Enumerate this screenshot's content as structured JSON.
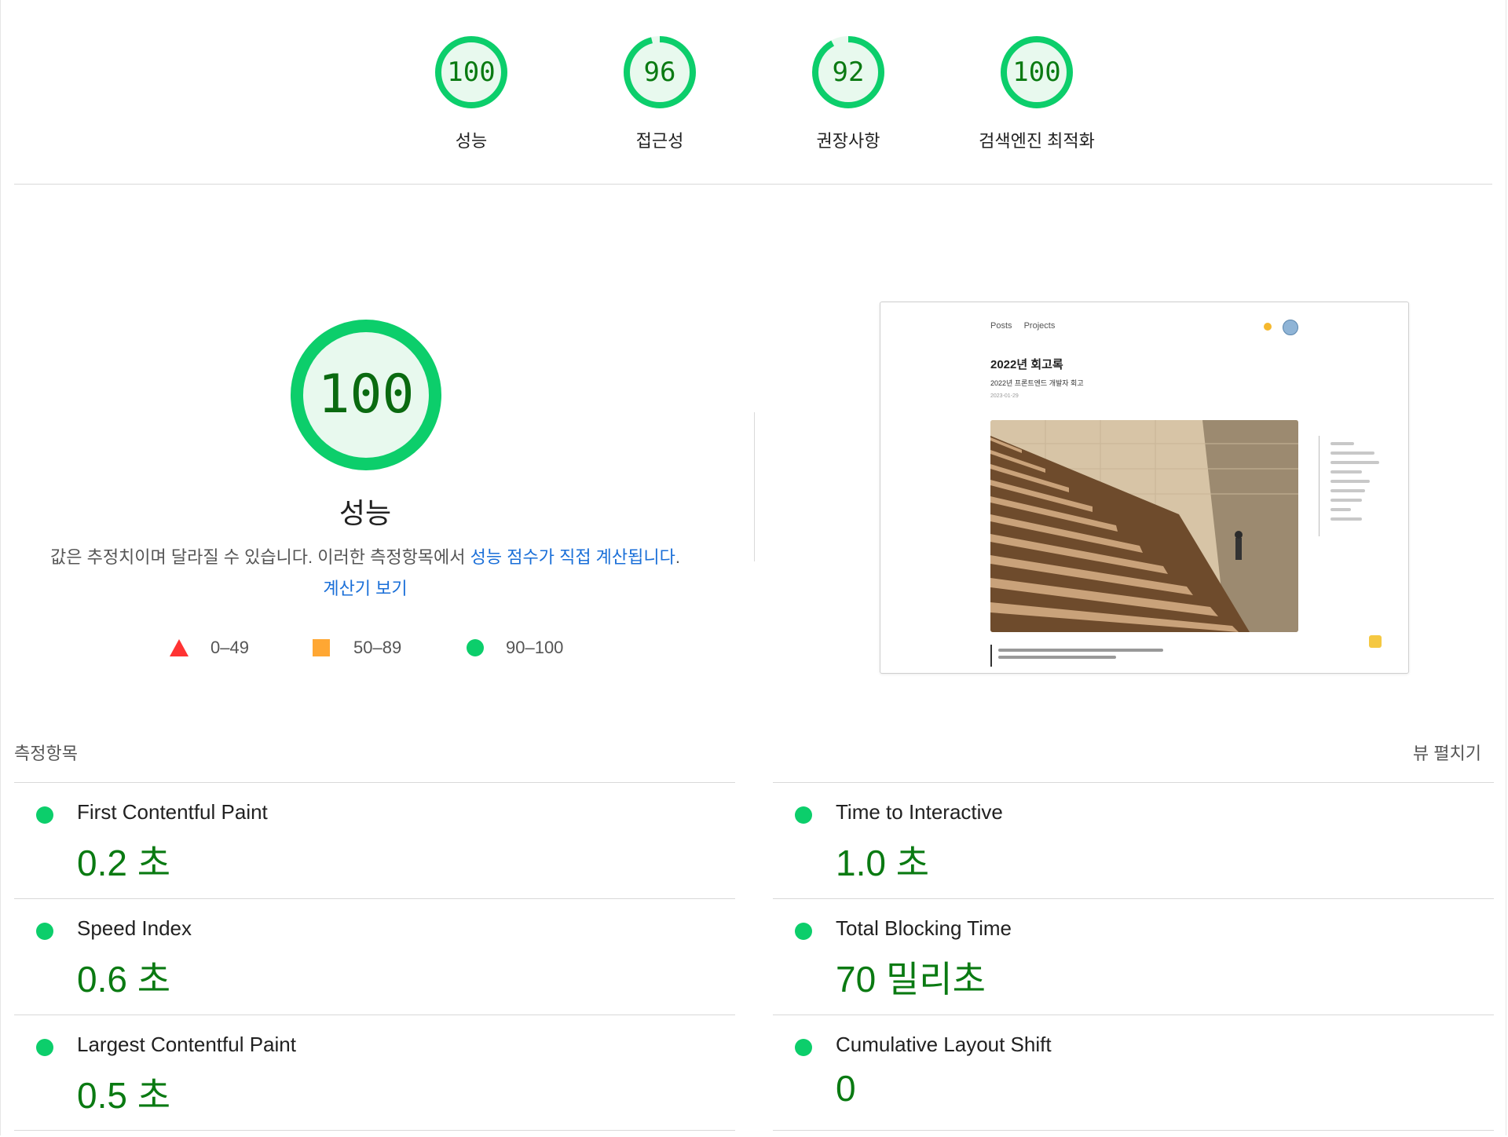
{
  "categories": [
    {
      "score": "100",
      "label": "성능",
      "fraction": 1.0
    },
    {
      "score": "96",
      "label": "접근성",
      "fraction": 0.96
    },
    {
      "score": "92",
      "label": "권장사항",
      "fraction": 0.92
    },
    {
      "score": "100",
      "label": "검색엔진 최적화",
      "fraction": 1.0
    }
  ],
  "performance": {
    "score": "100",
    "fraction": 1.0,
    "title": "성능",
    "desc_text": "값은 추정치이며 달라질 수 있습니다. 이러한 측정항목에서 ",
    "desc_link1": "성능 점수가 직접 계산됩니다",
    "desc_sep": ". ",
    "desc_link2": "계산기 보기",
    "legend": [
      {
        "shape": "triangle",
        "range": "0–49",
        "color": "#ff3333"
      },
      {
        "shape": "square",
        "range": "50–89",
        "color": "#ffa733"
      },
      {
        "shape": "circle",
        "range": "90–100",
        "color": "#0cce6b"
      }
    ]
  },
  "screenshot": {
    "nav": [
      "Posts",
      "Projects"
    ],
    "title": "2022년 회고록",
    "subtitle": "2022년 프론트엔드 개발자 회고",
    "date": "2023-01-29"
  },
  "metrics_section": {
    "title": "측정항목",
    "expand_label": "뷰 펼치기"
  },
  "metrics": [
    {
      "name": "First Contentful Paint",
      "value": "0.2 초"
    },
    {
      "name": "Time to Interactive",
      "value": "1.0 초"
    },
    {
      "name": "Speed Index",
      "value": "0.6 초"
    },
    {
      "name": "Total Blocking Time",
      "value": "70 밀리초"
    },
    {
      "name": "Largest Contentful Paint",
      "value": "0.5 초"
    },
    {
      "name": "Cumulative Layout Shift",
      "value": "0"
    }
  ],
  "colors": {
    "pass": "#0cce6b",
    "pass_text": "#0a7a12",
    "link": "#1a6fd8"
  }
}
